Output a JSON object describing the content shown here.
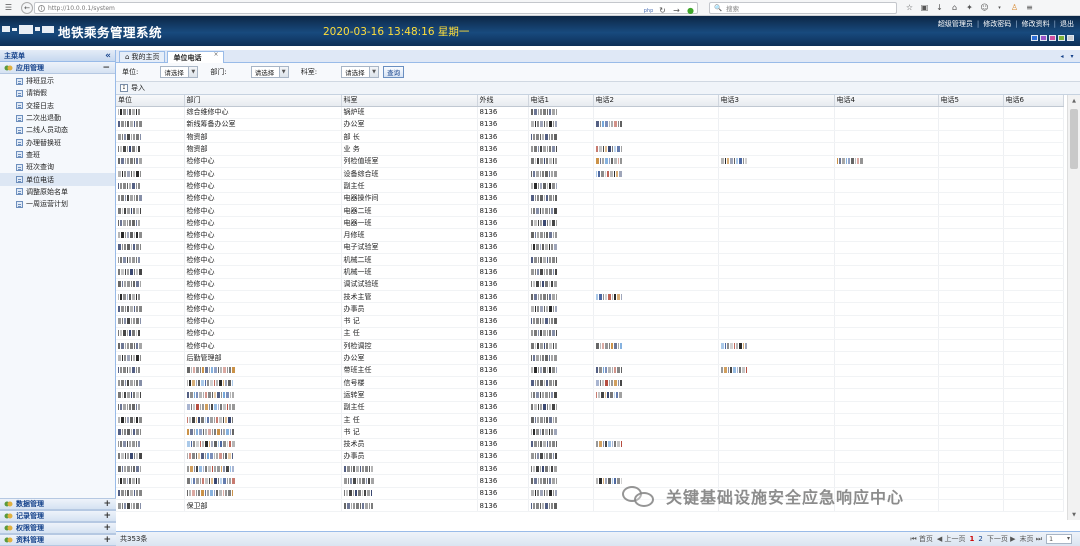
{
  "browser": {
    "url_text": "http://10.0.0.1/system",
    "search_placeholder": "搜索"
  },
  "header": {
    "title": "地铁乘务管理系统",
    "datetime": "2020-03-16 13:48:16 星期一",
    "links": [
      "超级管理员",
      "修改密码",
      "修改资料",
      "退出"
    ],
    "theme_colors": [
      "#2f6fd6",
      "#9a55c9",
      "#d04fa0",
      "#7fb03a",
      "#c9ccd1"
    ]
  },
  "sidebar": {
    "title": "主菜单",
    "collapse_glyph": "«",
    "group_open": {
      "label": "应用管理",
      "toggle": "−"
    },
    "items": [
      "排班显示",
      "请销假",
      "交接日志",
      "二次出退勤",
      "二线人员动态",
      "办理替换班",
      "查班",
      "班次查询",
      "单位电话",
      "调整原始名单",
      "一周运营计划"
    ],
    "active_index": 8,
    "groups_collapsed": [
      {
        "label": "数据管理",
        "toggle": "+"
      },
      {
        "label": "记录管理",
        "toggle": "+"
      },
      {
        "label": "权限管理",
        "toggle": "+"
      },
      {
        "label": "资料管理",
        "toggle": "+"
      }
    ]
  },
  "tabs": [
    {
      "label": "我的主页",
      "active": false
    },
    {
      "label": "单位电话",
      "active": true,
      "close": "×"
    }
  ],
  "filters": {
    "unit_label": "单位:",
    "dept_label": "部门:",
    "room_label": "科室:",
    "select_placeholder": "请选择",
    "query_button": "查询"
  },
  "toolbar": {
    "import_label": "导入"
  },
  "grid": {
    "columns": [
      "单位",
      "部门",
      "科室",
      "外线",
      "电话1",
      "电话2",
      "电话3",
      "电话4",
      "电话5",
      "电话6"
    ],
    "rows": [
      {
        "dept": "综合维修中心",
        "room": "锅炉班",
        "ext": "8136"
      },
      {
        "dept": "新线筹备办公室",
        "room": "办公室",
        "ext": "8136"
      },
      {
        "dept": "物资部",
        "room": "部 长",
        "ext": "8136"
      },
      {
        "dept": "物资部",
        "room": "业 务",
        "ext": "8136"
      },
      {
        "dept": "检修中心",
        "room": "列检值班室",
        "ext": "8136"
      },
      {
        "dept": "检修中心",
        "room": "设备综合班",
        "ext": "8136"
      },
      {
        "dept": "检修中心",
        "room": "副主任",
        "ext": "8136"
      },
      {
        "dept": "检修中心",
        "room": "电器操作间",
        "ext": "8136"
      },
      {
        "dept": "检修中心",
        "room": "电器二班",
        "ext": "8136"
      },
      {
        "dept": "检修中心",
        "room": "电器一班",
        "ext": "8136"
      },
      {
        "dept": "检修中心",
        "room": "月修班",
        "ext": "8136"
      },
      {
        "dept": "检修中心",
        "room": "电子试验室",
        "ext": "8136"
      },
      {
        "dept": "检修中心",
        "room": "机械二班",
        "ext": "8136"
      },
      {
        "dept": "检修中心",
        "room": "机械一班",
        "ext": "8136"
      },
      {
        "dept": "检修中心",
        "room": "调试试验班",
        "ext": "8136"
      },
      {
        "dept": "检修中心",
        "room": "技术主管",
        "ext": "8136"
      },
      {
        "dept": "检修中心",
        "room": "办事员",
        "ext": "8136"
      },
      {
        "dept": "检修中心",
        "room": "书 记",
        "ext": "8136"
      },
      {
        "dept": "检修中心",
        "room": "主 任",
        "ext": "8136"
      },
      {
        "dept": "检修中心",
        "room": "列检调控",
        "ext": "8136"
      },
      {
        "dept": "后勤管理部",
        "room": "办公室",
        "ext": "8136"
      },
      {
        "dept": "",
        "room": "带班主任",
        "ext": "8136"
      },
      {
        "dept": "",
        "room": "信号楼",
        "ext": "8136"
      },
      {
        "dept": "",
        "room": "运转室",
        "ext": "8136"
      },
      {
        "dept": "",
        "room": "副主任",
        "ext": "8136"
      },
      {
        "dept": "",
        "room": "主 任",
        "ext": "8136"
      },
      {
        "dept": "",
        "room": "书 记",
        "ext": "8136"
      },
      {
        "dept": "",
        "room": "技术员",
        "ext": "8136"
      },
      {
        "dept": "",
        "room": "办事员",
        "ext": "8136"
      },
      {
        "dept": "",
        "room": "",
        "ext": "8136"
      },
      {
        "dept": "",
        "room": "",
        "ext": "8136"
      },
      {
        "dept": "",
        "room": "",
        "ext": "8136"
      },
      {
        "dept": "保卫部",
        "room": "",
        "ext": "8136"
      }
    ]
  },
  "footer": {
    "total": "共353条",
    "first": "首页",
    "prev": "上一页",
    "pages": [
      "1",
      "2"
    ],
    "next": "下一页",
    "last": "末页",
    "page_select": "1"
  },
  "watermark": {
    "text": "关键基础设施安全应急响应中心",
    "icon": "wechat-icon"
  }
}
